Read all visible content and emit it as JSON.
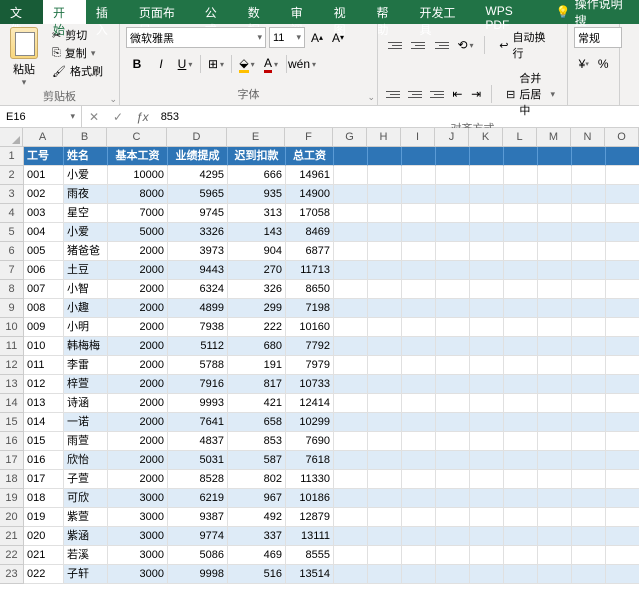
{
  "menus": {
    "file": "文件",
    "home": "开始",
    "insert": "插入",
    "layout": "页面布局",
    "formula": "公式",
    "data": "数据",
    "review": "审阅",
    "view": "视图",
    "help": "帮助",
    "dev": "开发工具",
    "wps": "WPS PDF",
    "tell": "操作说明搜"
  },
  "clipboard": {
    "paste": "粘贴",
    "cut": "剪切",
    "copy": "复制",
    "painter": "格式刷",
    "group": "剪贴板"
  },
  "font": {
    "name": "微软雅黑",
    "size": "11",
    "group": "字体"
  },
  "align": {
    "wrap": "自动换行",
    "merge": "合并后居中",
    "group": "对齐方式"
  },
  "number": {
    "format": "常规"
  },
  "namebox": "E16",
  "formula": "853",
  "colsLetters": [
    "A",
    "B",
    "C",
    "D",
    "E",
    "F",
    "G",
    "H",
    "I",
    "J",
    "K",
    "L",
    "M",
    "N",
    "O"
  ],
  "headers": [
    "工号",
    "姓名",
    "基本工资",
    "业绩提成",
    "迟到扣款",
    "总工资"
  ],
  "rows": [
    [
      "001",
      "小爱",
      "10000",
      "4295",
      "666",
      "14961"
    ],
    [
      "002",
      "雨夜",
      "8000",
      "5965",
      "935",
      "14900"
    ],
    [
      "003",
      "星空",
      "7000",
      "9745",
      "313",
      "17058"
    ],
    [
      "004",
      "小爱",
      "5000",
      "3326",
      "143",
      "8469"
    ],
    [
      "005",
      "猪爸爸",
      "2000",
      "3973",
      "904",
      "6877"
    ],
    [
      "006",
      "土豆",
      "2000",
      "9443",
      "270",
      "11713"
    ],
    [
      "007",
      "小智",
      "2000",
      "6324",
      "326",
      "8650"
    ],
    [
      "008",
      "小趣",
      "2000",
      "4899",
      "299",
      "7198"
    ],
    [
      "009",
      "小明",
      "2000",
      "7938",
      "222",
      "10160"
    ],
    [
      "010",
      "韩梅梅",
      "2000",
      "5112",
      "680",
      "7792"
    ],
    [
      "011",
      "李雷",
      "2000",
      "5788",
      "191",
      "7979"
    ],
    [
      "012",
      "梓萱",
      "2000",
      "7916",
      "817",
      "10733"
    ],
    [
      "013",
      "诗涵",
      "2000",
      "9993",
      "421",
      "12414"
    ],
    [
      "014",
      "一诺",
      "2000",
      "7641",
      "658",
      "10299"
    ],
    [
      "015",
      "雨萱",
      "2000",
      "4837",
      "853",
      "7690"
    ],
    [
      "016",
      "欣怡",
      "2000",
      "5031",
      "587",
      "7618"
    ],
    [
      "017",
      "子萱",
      "2000",
      "8528",
      "802",
      "11330"
    ],
    [
      "018",
      "可欣",
      "3000",
      "6219",
      "967",
      "10186"
    ],
    [
      "019",
      "紫萱",
      "3000",
      "9387",
      "492",
      "12879"
    ],
    [
      "020",
      "紫涵",
      "3000",
      "9774",
      "337",
      "13111"
    ],
    [
      "021",
      "若溪",
      "3000",
      "5086",
      "469",
      "8555"
    ],
    [
      "022",
      "子轩",
      "3000",
      "9998",
      "516",
      "13514"
    ]
  ]
}
